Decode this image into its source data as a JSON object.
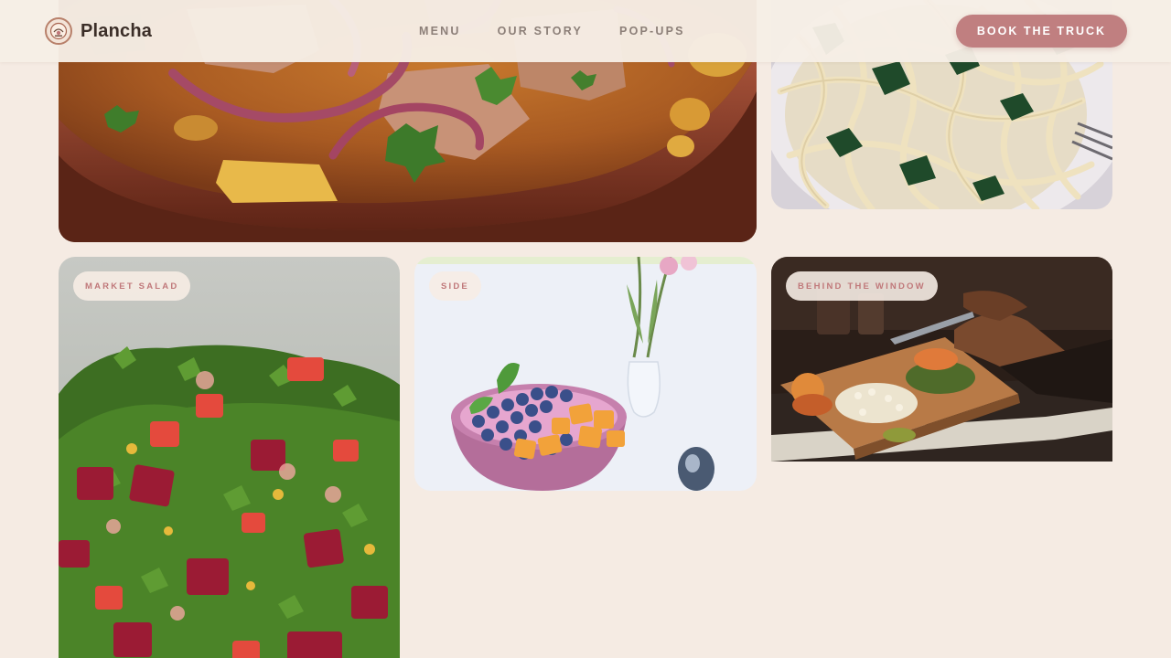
{
  "header": {
    "brand": "Plancha",
    "logo_icon": "food-truck-emblem-icon",
    "nav": [
      "MENU",
      "OUR STORY",
      "POP-UPS"
    ],
    "cta_label": "BOOK THE TRUCK"
  },
  "gallery": {
    "cards": [
      {
        "tag": "",
        "photo": "stew-bowl-photo"
      },
      {
        "tag": "",
        "photo": "spinach-pasta-photo"
      },
      {
        "tag": "MARKET SALAD",
        "photo": "beet-salad-photo"
      },
      {
        "tag": "SIDE",
        "photo": "fruit-bowl-photo"
      },
      {
        "tag": "BEHIND THE WINDOW",
        "photo": "chopping-board-photo"
      }
    ]
  },
  "colors": {
    "background": "#f5ebe3",
    "accent": "#c07f80",
    "tag_text": "#c0787a",
    "brand_text": "#3b2e28",
    "nav_text": "#8c7f78"
  }
}
